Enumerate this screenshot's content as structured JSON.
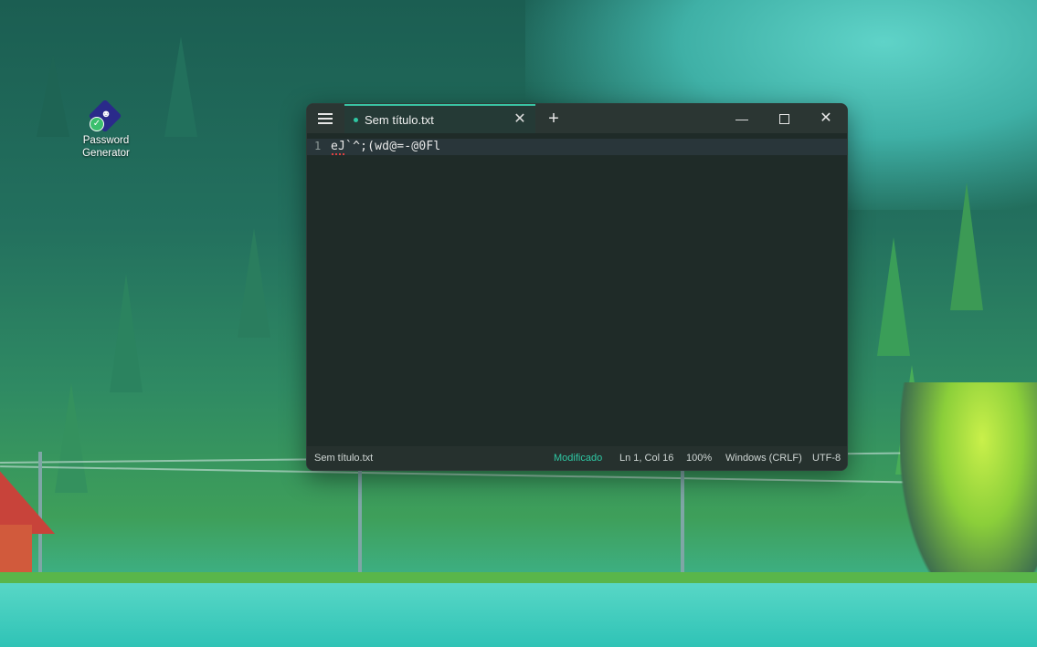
{
  "desktop": {
    "icons": [
      {
        "label": "Password Generator",
        "icon": "password-generator-icon"
      }
    ]
  },
  "window": {
    "tab": {
      "title": "Sem título.txt",
      "modified_dot_color": "#2fc7a3"
    },
    "menu_icon": "hamburger-icon",
    "new_tab_label": "+",
    "controls": {
      "minimize": "—",
      "maximize": "",
      "close": "✕"
    },
    "editor": {
      "lines": [
        {
          "number": "1",
          "text": "eJ`^;(wd@=-@0Fl"
        }
      ]
    },
    "status": {
      "file": "Sem título.txt",
      "modified": "Modificado",
      "position": "Ln 1, Col 16",
      "zoom": "100%",
      "line_ending": "Windows (CRLF)",
      "encoding": "UTF-8"
    }
  },
  "colors": {
    "accent": "#2fc7a3",
    "window_bg": "#1f2b28",
    "titlebar_bg": "#2b3633"
  }
}
